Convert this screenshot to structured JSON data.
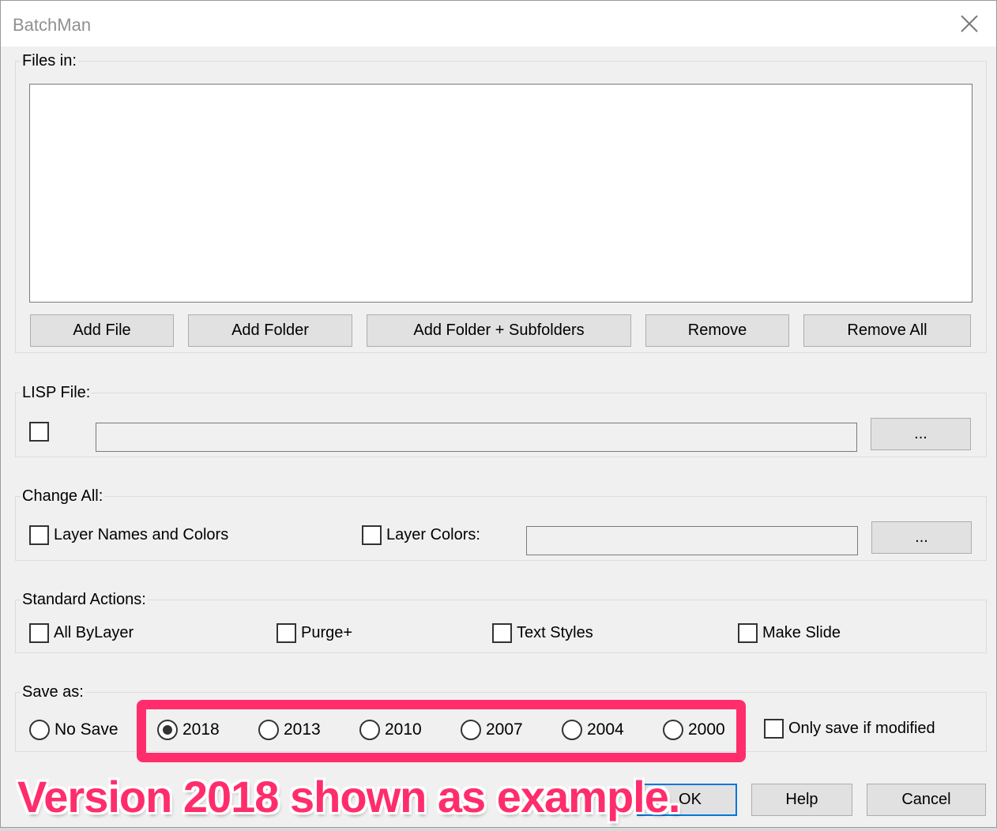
{
  "window": {
    "title": "BatchMan",
    "close_icon": "close-icon"
  },
  "files_in": {
    "label": "Files in:",
    "items": [],
    "buttons": {
      "add_file": "Add File",
      "add_folder": "Add Folder",
      "add_folder_subfolders": "Add Folder + Subfolders",
      "remove": "Remove",
      "remove_all": "Remove All"
    }
  },
  "lisp_file": {
    "label": "LISP File:",
    "checked": false,
    "path_value": "",
    "browse_label": "..."
  },
  "change_all": {
    "label": "Change All:",
    "layer_names_colors": {
      "label": "Layer Names and Colors",
      "checked": false
    },
    "layer_colors": {
      "label": "Layer Colors:",
      "checked": false,
      "value": ""
    },
    "browse_label": "..."
  },
  "standard_actions": {
    "label": "Standard Actions:",
    "items": [
      {
        "label": "All ByLayer",
        "checked": false
      },
      {
        "label": "Purge+",
        "checked": false
      },
      {
        "label": "Text Styles",
        "checked": false
      },
      {
        "label": "Make Slide",
        "checked": false
      }
    ]
  },
  "save_as": {
    "label": "Save as:",
    "options": [
      "No Save",
      "2018",
      "2013",
      "2010",
      "2007",
      "2004",
      "2000"
    ],
    "selected": "2018",
    "only_if_modified": {
      "label": "Only save if modified",
      "checked": false
    }
  },
  "footer": {
    "ok": "OK",
    "help": "Help",
    "cancel": "Cancel"
  },
  "annotation": {
    "text": "Version 2018 shown as example.",
    "color": "#ff2d6b"
  }
}
